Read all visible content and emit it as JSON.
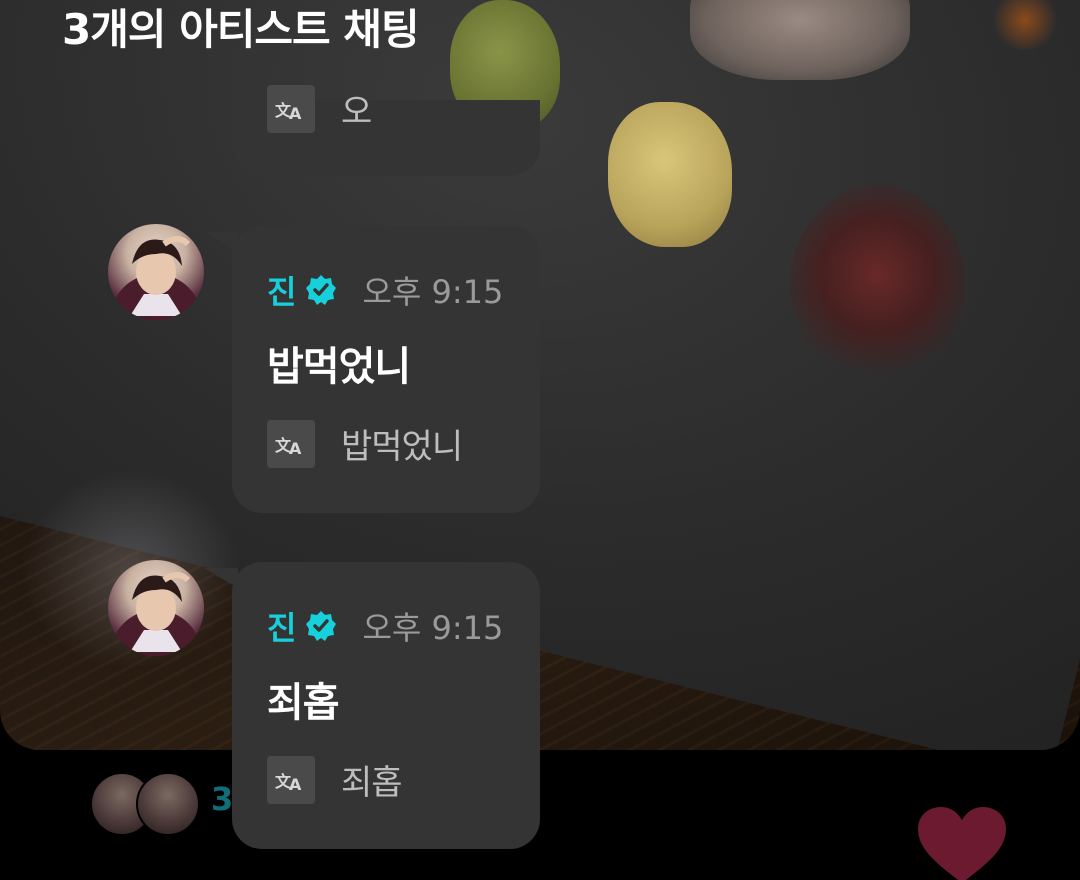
{
  "header": {
    "title": "3개의 아티스트 채팅"
  },
  "colors": {
    "accent": "#17d0dc",
    "bubble_bg": "#343434",
    "time_text": "#9a9a9a",
    "heart": "#6b1a30"
  },
  "messages": [
    {
      "partial": true,
      "translation": "오"
    },
    {
      "sender": "진",
      "verified": true,
      "time": "오후 9:15",
      "text": "밥먹었니",
      "translation": "밥먹었니"
    },
    {
      "sender": "진",
      "verified": true,
      "time": "오후 9:15",
      "text": "죄홉",
      "translation": "죄홉"
    }
  ],
  "footer": {
    "participants_count": "3",
    "heart_icon": "heart-icon"
  },
  "icons": {
    "translate": "translate-icon",
    "verified": "verified-badge-icon"
  }
}
